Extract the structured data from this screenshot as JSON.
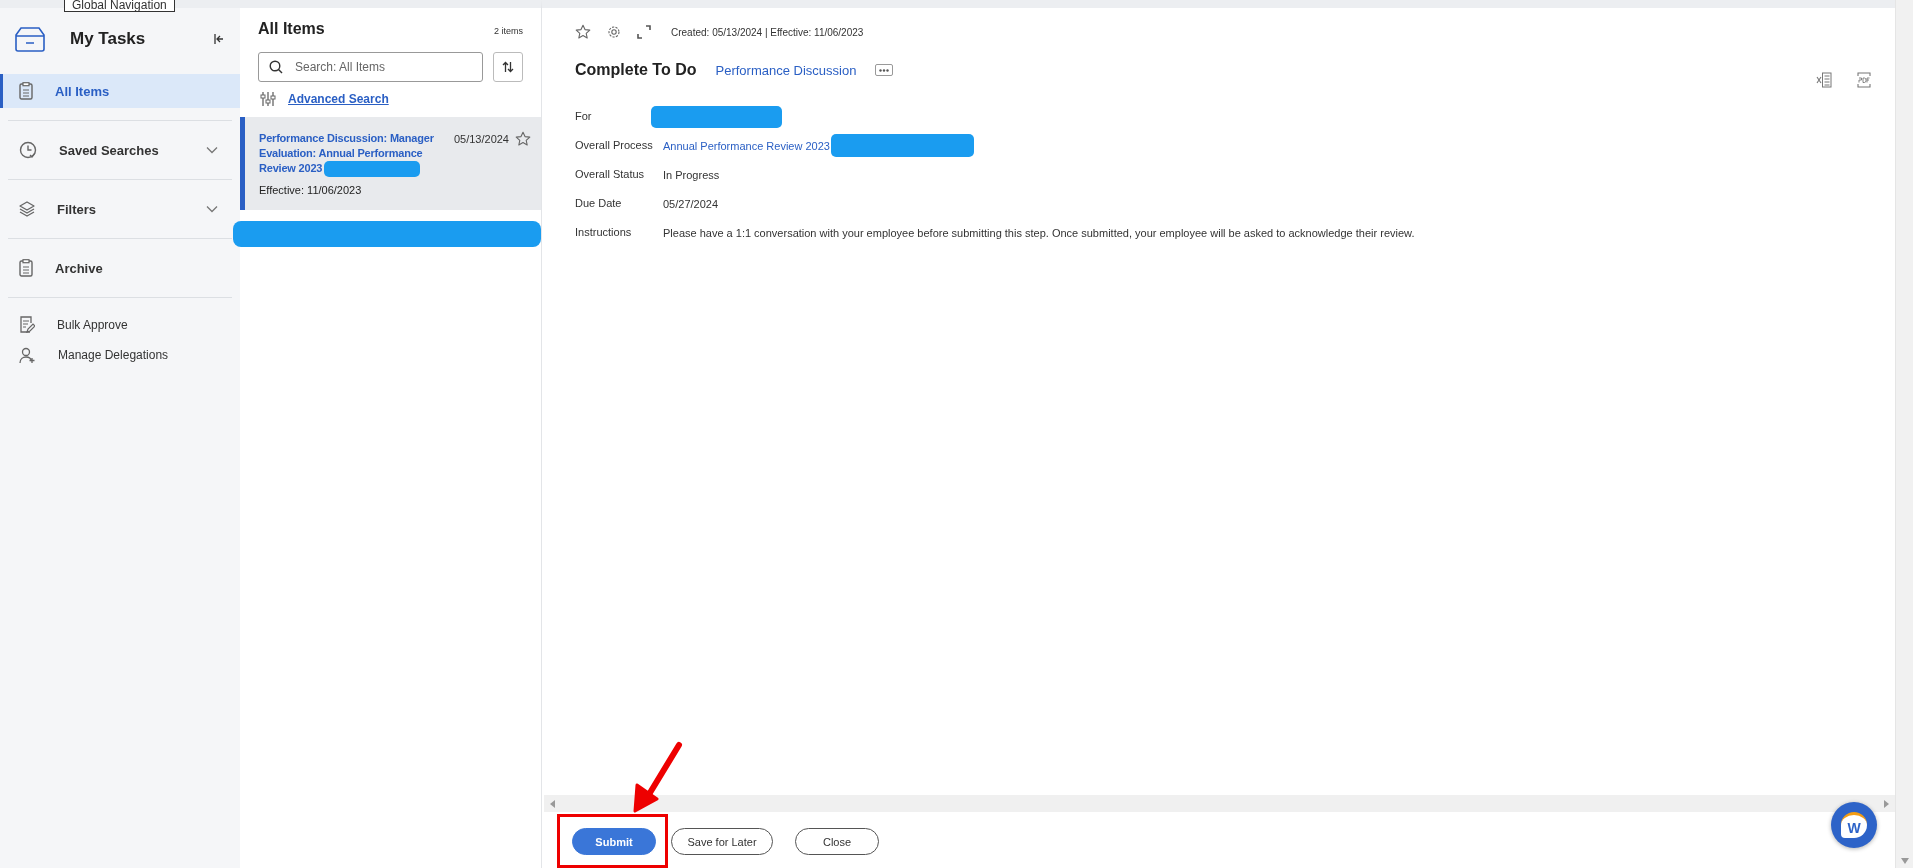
{
  "tooltip": {
    "text": "Global Navigation"
  },
  "sidebar": {
    "title": "My Tasks",
    "items": [
      {
        "label": "All Items",
        "kind": "link",
        "selected": true
      },
      {
        "label": "Saved Searches",
        "kind": "group",
        "selected": false,
        "expanded": false
      },
      {
        "label": "Filters",
        "kind": "group",
        "selected": false,
        "expanded": false
      },
      {
        "label": "Archive",
        "kind": "link",
        "selected": false
      }
    ],
    "actions": [
      {
        "label": "Bulk Approve"
      },
      {
        "label": "Manage Delegations"
      }
    ]
  },
  "list": {
    "title": "All Items",
    "count": "2 items",
    "search": {
      "placeholder": "Search: All Items"
    },
    "advanced_search": "Advanced Search",
    "items": [
      {
        "title": "Performance Discussion: Manager Evaluation: Annual Performance Review 2023",
        "date": "05/13/2024",
        "effective": "Effective: 11/06/2023",
        "selected": true,
        "starred": false,
        "redacted": true
      }
    ]
  },
  "detail": {
    "meta": "Created: 05/13/2024 | Effective: 11/06/2023",
    "title": "Complete To Do",
    "subtitle": "Performance Discussion",
    "fields": [
      {
        "label": "For",
        "redacted": true
      },
      {
        "label": "Overall Process",
        "value": "Annual Performance Review 2023",
        "link": true,
        "redacted": true
      },
      {
        "label": "Overall Status",
        "value": "In Progress",
        "link": false,
        "redacted": false
      },
      {
        "label": "Due Date",
        "value": "05/27/2024",
        "link": false,
        "redacted": false
      },
      {
        "label": "Instructions",
        "value": "Please have a 1:1 conversation with your employee before submitting this step. Once submitted, your employee will be asked to acknowledge their review.",
        "link": false,
        "redacted": false
      }
    ]
  },
  "buttons": [
    {
      "label": "Submit",
      "kind": "primary",
      "highlighted": true
    },
    {
      "label": "Save for Later",
      "kind": "secondary",
      "highlighted": false
    },
    {
      "label": "Close",
      "kind": "secondary",
      "highlighted": false
    }
  ],
  "chat": {
    "label": "W"
  }
}
